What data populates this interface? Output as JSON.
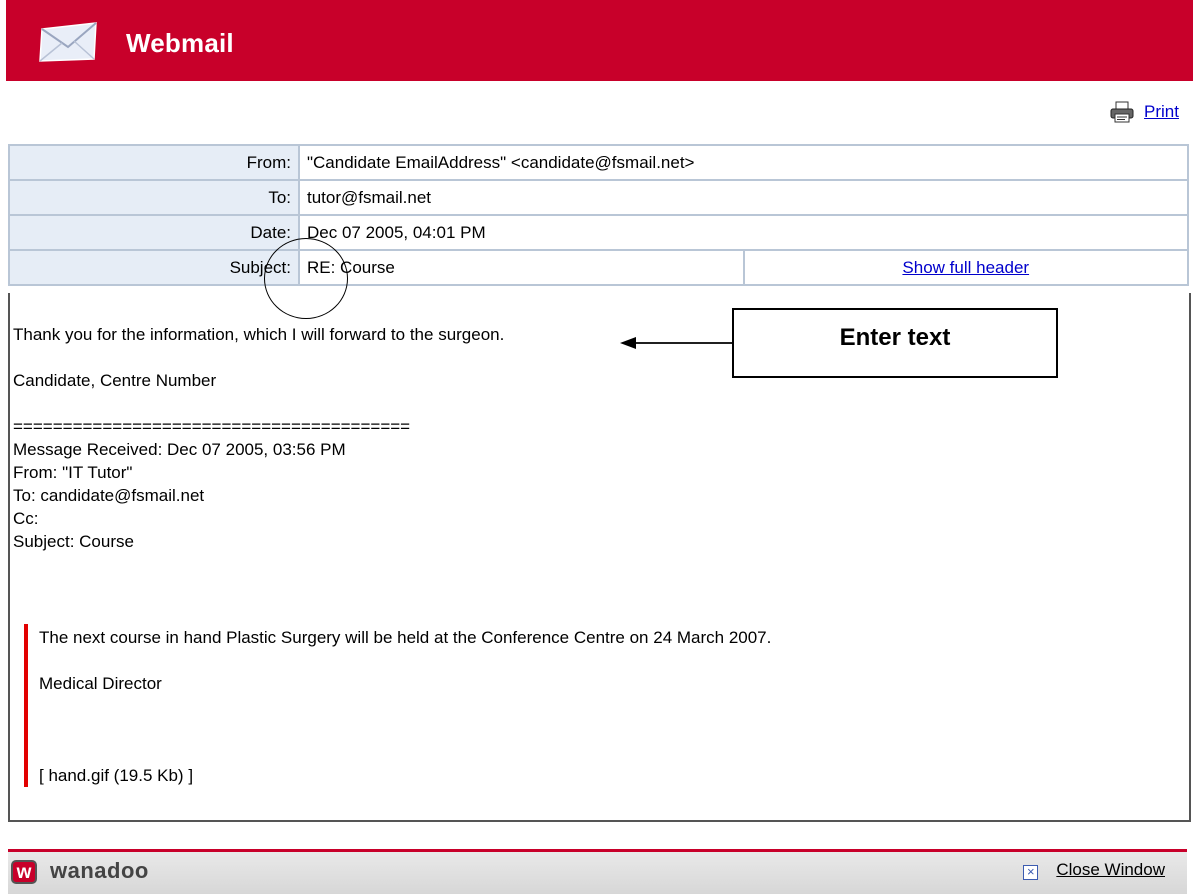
{
  "app": {
    "title": "Webmail"
  },
  "toolbar": {
    "print_label": "Print"
  },
  "header": {
    "from_label": "From:",
    "from_value": "\"Candidate EmailAddress\" <candidate@fsmail.net>",
    "to_label": "To:",
    "to_value": "tutor@fsmail.net",
    "date_label": "Date:",
    "date_value": "Dec 07 2005, 04:01 PM",
    "subject_label": "Subject:",
    "subject_value": "RE: Course",
    "show_full_header": "Show full header"
  },
  "message": {
    "reply_line": "Thank you for the information, which I will forward to the surgeon.",
    "signature": "Candidate, Centre Number",
    "separator": "========================================",
    "received": "Message Received: Dec 07 2005, 03:56 PM",
    "orig_from": "From: \"IT Tutor\"",
    "orig_to": "To: candidate@fsmail.net",
    "orig_cc": "Cc:",
    "orig_subject": "Subject: Course",
    "quote_text": "The next course in hand Plastic Surgery will be held at the Conference Centre on 24 March 2007.",
    "quote_signature": "Medical Director",
    "attachment": "[ hand.gif (19.5 Kb) ]"
  },
  "annotation": {
    "callout_label": "Enter text"
  },
  "footer": {
    "brand": "wanadoo",
    "logo_letter": "w",
    "close_label": "Close Window"
  },
  "colors": {
    "brand_red": "#c8002a",
    "quote_bar": "#e20000",
    "header_label_bg": "#e6edf6",
    "link": "#0000cc"
  }
}
